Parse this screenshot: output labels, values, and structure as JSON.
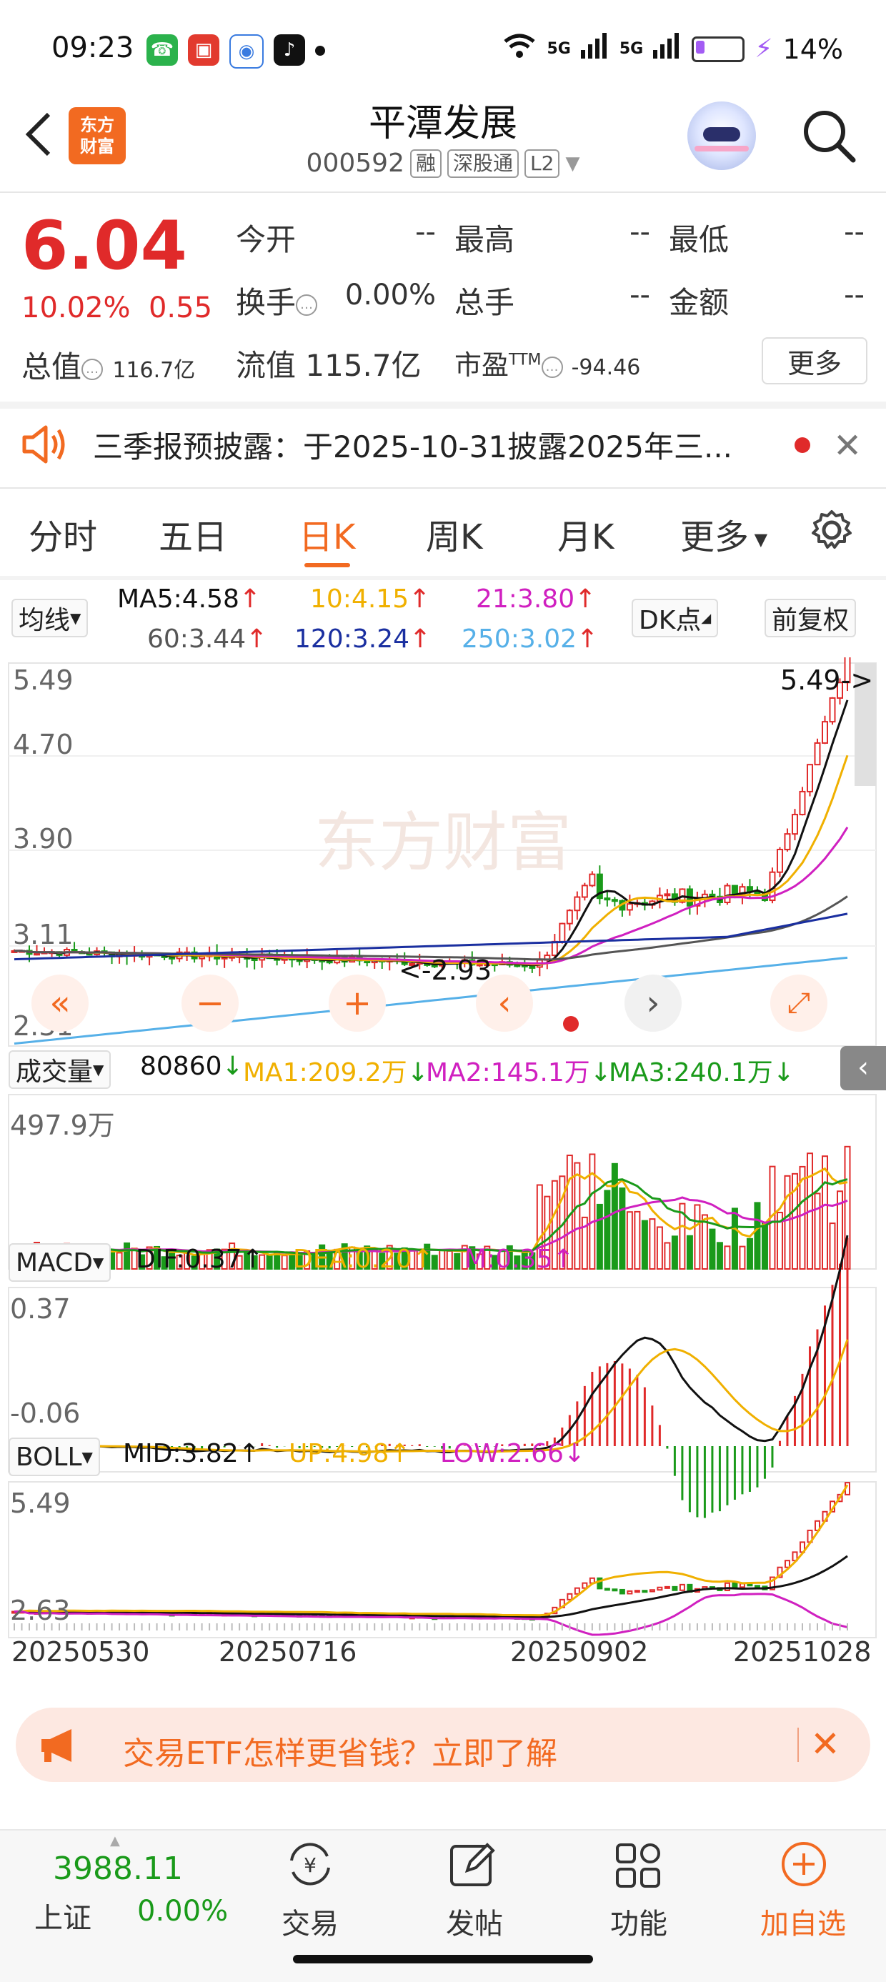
{
  "status_bar": {
    "time": "09:23",
    "network": "5G",
    "battery": "14%"
  },
  "header": {
    "logo_text": "东方\n财富",
    "stock_name": "平潭发展",
    "stock_code": "000592",
    "tags": [
      "融",
      "深股通",
      "L2"
    ]
  },
  "quote": {
    "price": "6.04",
    "change_pct": "10.02%",
    "change_abs": "0.55",
    "open_label": "今开",
    "open_value": "--",
    "high_label": "最高",
    "high_value": "--",
    "low_label": "最低",
    "low_value": "--",
    "turnover_label": "换手",
    "turnover_value": "0.00%",
    "volume_label": "总手",
    "volume_value": "--",
    "amount_label": "金额",
    "amount_value": "--",
    "mcap_label": "总值",
    "mcap_value": "116.7亿",
    "float_label": "流值",
    "float_value": "115.7亿",
    "pe_label": "市盈",
    "pe_sup": "TTM",
    "pe_value": "-94.46",
    "more_label": "更多"
  },
  "notice": {
    "text": "三季报预披露：于2025-10-31披露2025年三..."
  },
  "tabs": [
    {
      "label": "分时"
    },
    {
      "label": "五日"
    },
    {
      "label": "日K"
    },
    {
      "label": "周K"
    },
    {
      "label": "月K"
    },
    {
      "label": "更多"
    }
  ],
  "ma_legend": {
    "select": "均线",
    "ma5": "MA5:4.58",
    "ma10": "10:4.15",
    "ma21": "21:3.80",
    "ma60": "60:3.44",
    "ma120": "120:3.24",
    "ma250": "250:3.02",
    "dk_label": "DK点",
    "fq_label": "前复权"
  },
  "kchart": {
    "y_top": "5.49",
    "y_2": "4.70",
    "y_3": "3.90",
    "y_4": "3.11",
    "y_bottom": "2.31",
    "max_marker": "5.49->",
    "min_marker": "<-2.93"
  },
  "volume": {
    "select": "成交量",
    "value": "80860",
    "ma1": "MA1:209.2万",
    "ma2": "MA2:145.1万",
    "ma3": "MA3:240.1万",
    "y_top": "497.9万"
  },
  "macd": {
    "select": "MACD",
    "dif": "DIF:0.37",
    "dea": "DEA:0.20",
    "m": "M:0.35",
    "y_top": "0.37",
    "y_bottom": "-0.06"
  },
  "boll": {
    "select": "BOLL",
    "mid": "MID:3.82",
    "up": "UP:4.98",
    "low": "LOW:2.66",
    "y_top": "5.49",
    "y_bottom": "2.63"
  },
  "x_axis": [
    "20250530",
    "20250716",
    "20250902",
    "20251028"
  ],
  "banner": {
    "text": "交易ETF怎样更省钱？立即了解"
  },
  "bottom_nav": {
    "index_value": "3988.11",
    "index_name": "上证",
    "index_change": "0.00%",
    "items": [
      {
        "label": "交易"
      },
      {
        "label": "发帖"
      },
      {
        "label": "功能"
      },
      {
        "label": "加自选"
      }
    ]
  },
  "colors": {
    "up": "#e02a2a",
    "down": "#1a9a1a",
    "brand": "#f26a21",
    "ma5": "#111111",
    "ma10": "#f0b000",
    "ma21": "#d020c0",
    "ma60": "#555555",
    "ma120": "#1a2fa0",
    "ma250": "#56b0e8"
  }
}
